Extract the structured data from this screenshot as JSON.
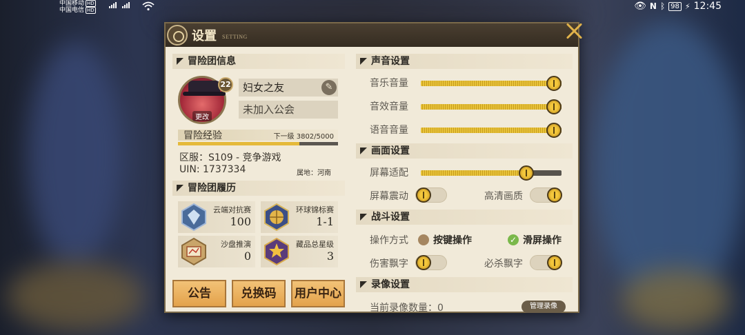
{
  "status_bar": {
    "carrier1": "中国移动",
    "carrier2": "中国电信",
    "hd": "HD",
    "battery": "98",
    "time": "12:45"
  },
  "dialog": {
    "title": "设置",
    "subtitle": "SETTING"
  },
  "profile": {
    "section_title": "冒险团信息",
    "avatar_edit": "更改",
    "level": "22",
    "name": "妇女之友",
    "guild": "未加入公会",
    "exp_label": "冒险经验",
    "exp_next": "下一级 3802/5000",
    "exp_progress": 0.76,
    "server": "区服：S109 - 竞争游戏",
    "uin": "UIN: 1737334",
    "location": "属地：河南"
  },
  "history": {
    "section_title": "冒险团履历",
    "cards": [
      {
        "label": "云端对抗赛",
        "value": "100",
        "icon": "crystal-badge-icon"
      },
      {
        "label": "环球锦标赛",
        "value": "1-1",
        "icon": "golden-globe-icon"
      },
      {
        "label": "沙盘推演",
        "value": "0",
        "icon": "sandbox-map-icon"
      },
      {
        "label": "藏品总星级",
        "value": "3",
        "icon": "star-trophy-icon"
      }
    ]
  },
  "buttons": {
    "notice": "公告",
    "redeem": "兑换码",
    "user_center": "用户中心"
  },
  "sound": {
    "section_title": "声音设置",
    "music": {
      "label": "音乐音量",
      "value": 1.0
    },
    "sfx": {
      "label": "音效音量",
      "value": 1.0
    },
    "voice": {
      "label": "语音音量",
      "value": 1.0
    }
  },
  "graphics": {
    "section_title": "画面设置",
    "screen_fit": {
      "label": "屏幕适配",
      "value": 0.75
    },
    "screen_shake": {
      "label": "屏幕震动",
      "on": false
    },
    "hd_quality": {
      "label": "高清画质",
      "on": true
    }
  },
  "battle": {
    "section_title": "战斗设置",
    "control_label": "操作方式",
    "option_buttons": "按键操作",
    "option_swipe": "滑屏操作",
    "damage_text": {
      "label": "伤害飘字",
      "on": false
    },
    "crit_text": {
      "label": "必杀飘字",
      "on": true
    }
  },
  "recording": {
    "section_title": "录像设置",
    "count": "当前录像数量：0",
    "manage": "管理录像"
  },
  "colors": {
    "accent_gold": "#e8c33a",
    "button_orange": "#e3a24b",
    "check_green": "#7ab84a"
  }
}
